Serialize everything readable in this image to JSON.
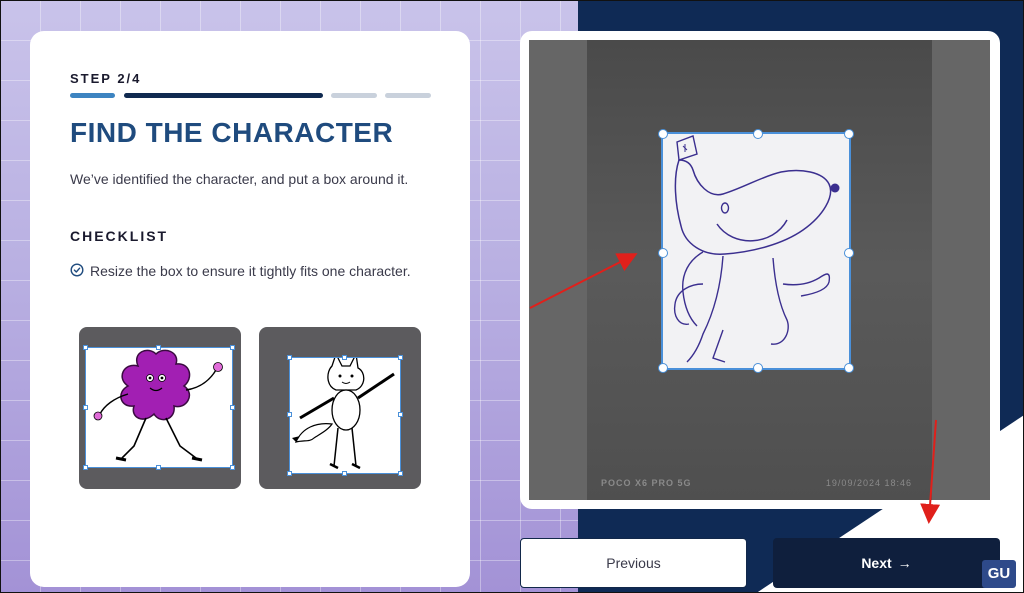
{
  "step": {
    "label": "STEP 2/4",
    "current": 2,
    "total": 4
  },
  "main": {
    "title": "FIND THE CHARACTER",
    "description": "We’ve identified the character, and put a box around it.",
    "checklist_title": "CHECKLIST",
    "checklist_items": [
      "Resize the box to ensure it tightly fits one character."
    ]
  },
  "photo": {
    "watermark_left": "POCO X6 PRO 5G",
    "watermark_right": "19/09/2024  18:46"
  },
  "buttons": {
    "previous_label": "Previous",
    "next_label": "Next",
    "next_icon": "arrow-right-icon"
  },
  "overlay": {
    "logo_text": "GU"
  },
  "colors": {
    "accent_navy": "#0f2a55",
    "title_blue": "#1f4b7e",
    "box_blue": "#4a90d9",
    "annotation_red": "#e0201b"
  }
}
